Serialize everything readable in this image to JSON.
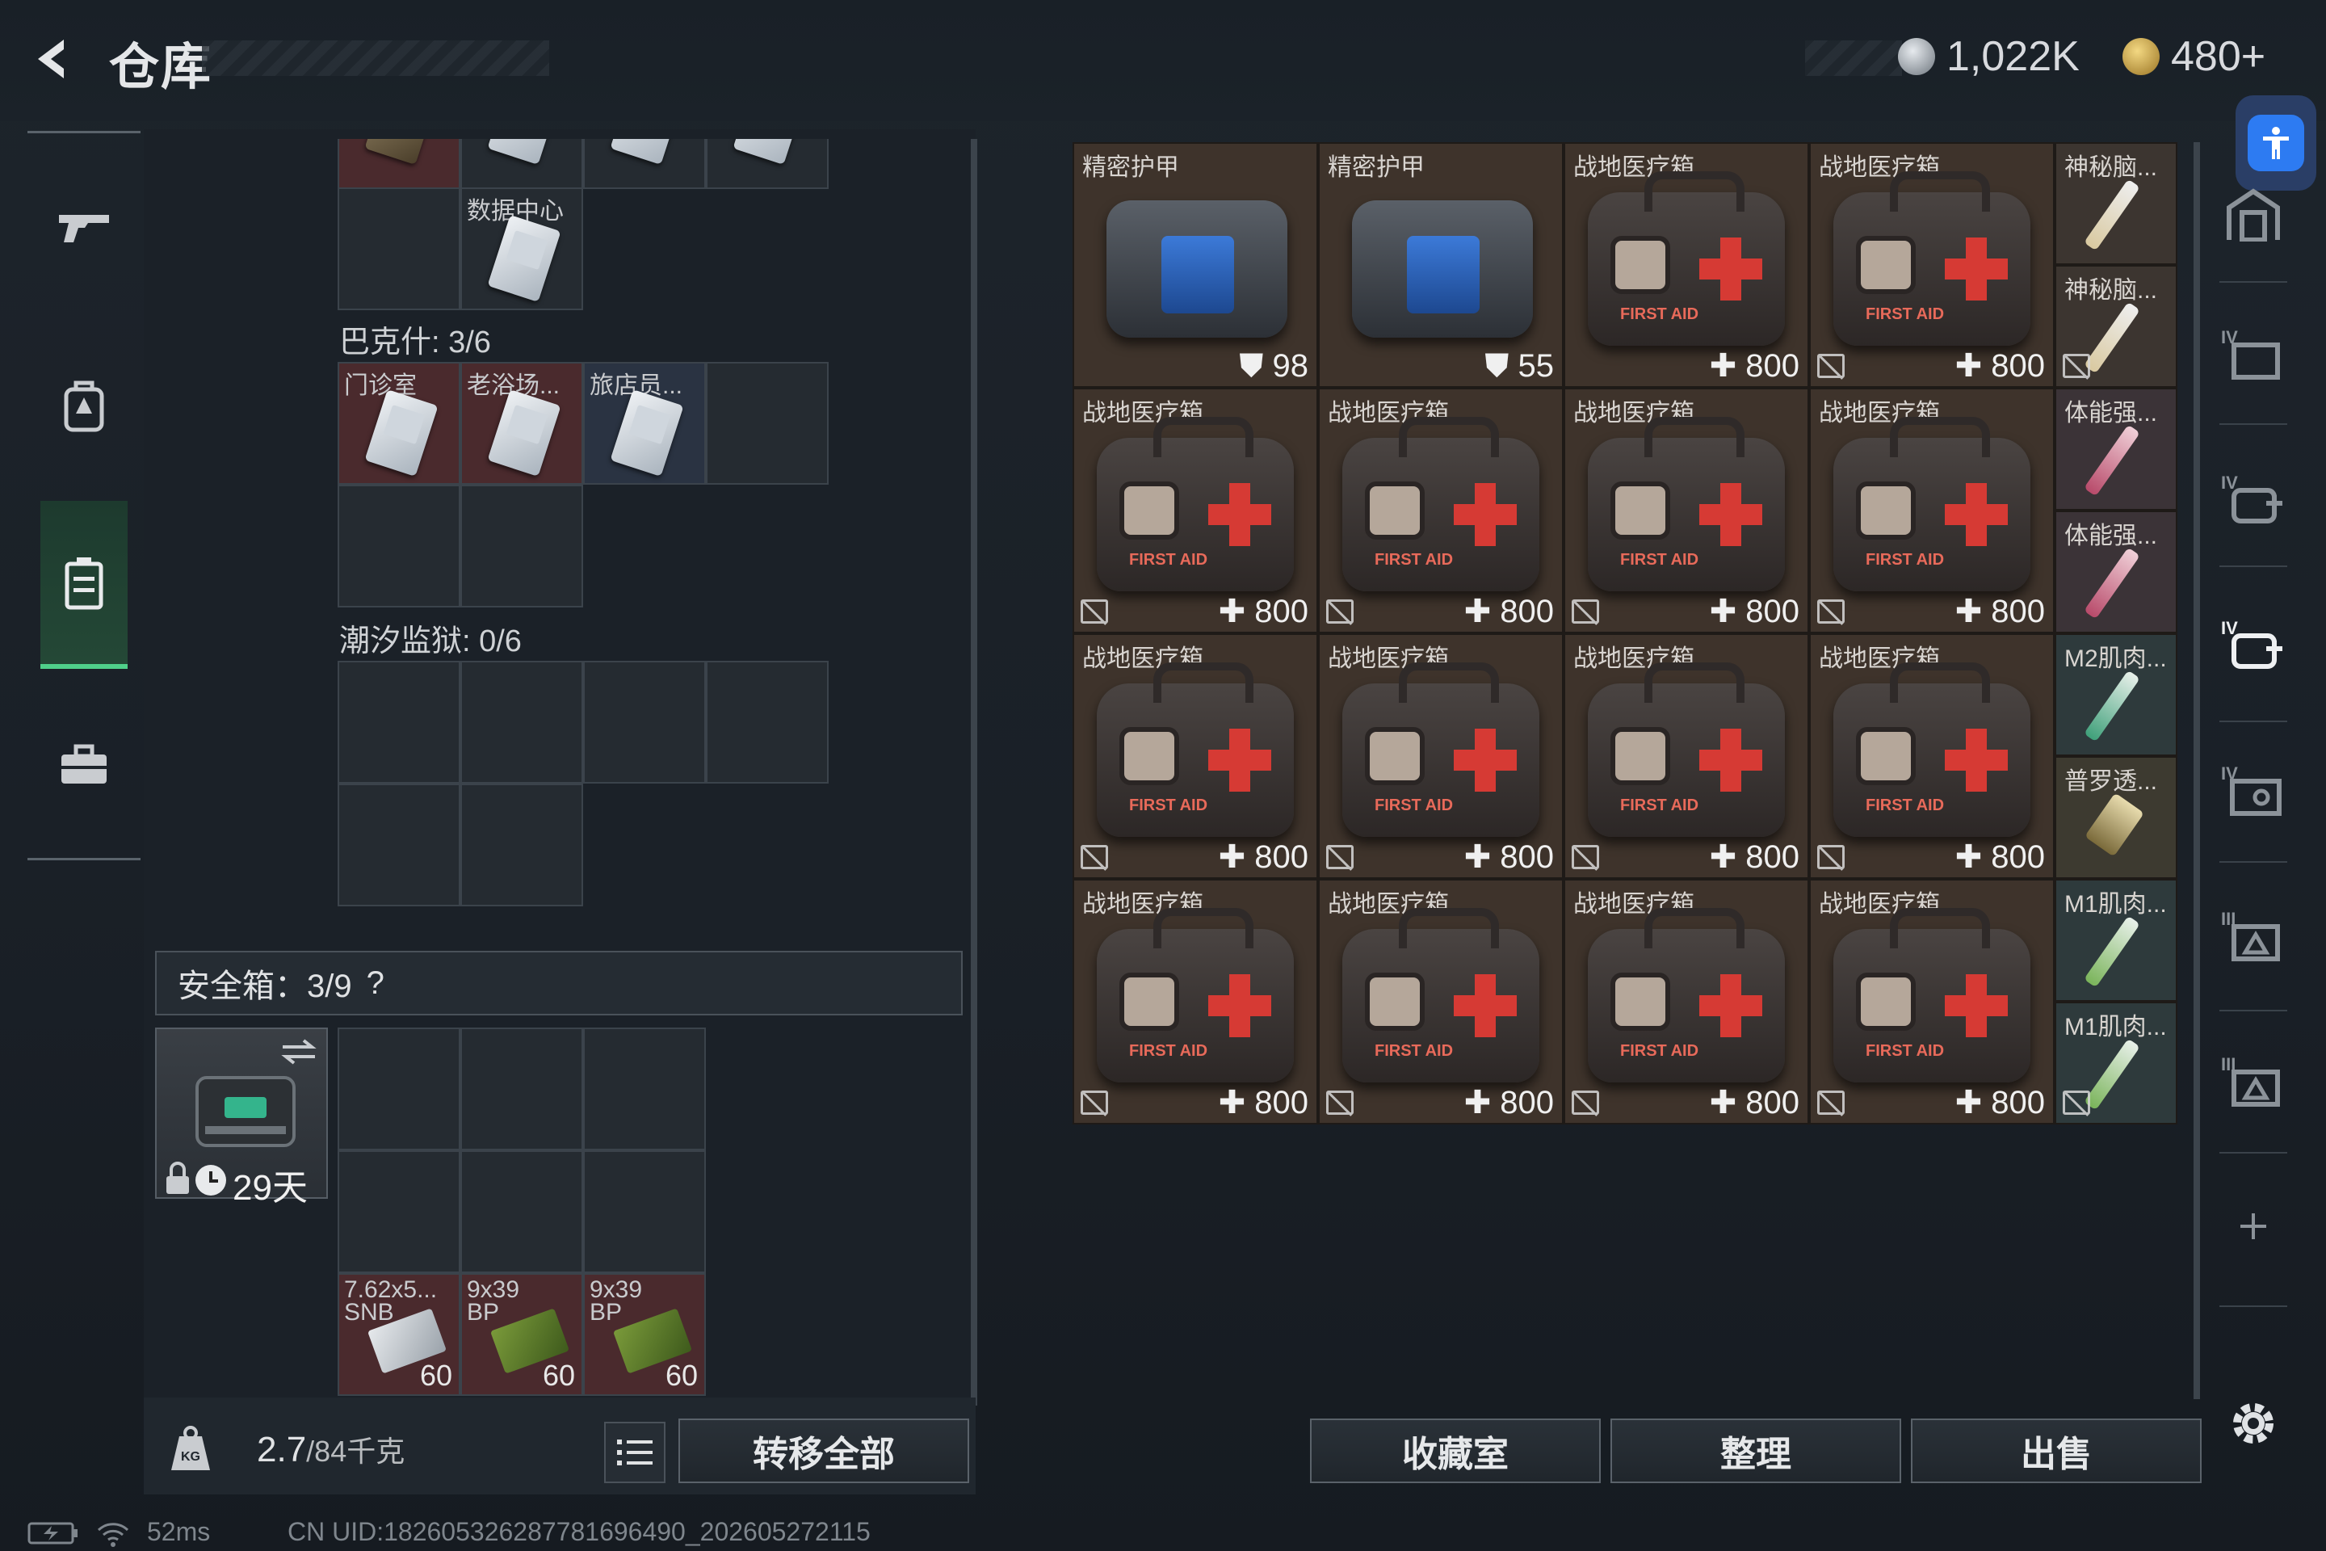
{
  "header": {
    "title": "仓库",
    "currency1": "1,022K",
    "currency2": "480+",
    "currency1_color": "#9aa3ad",
    "currency2_color": "#c8a24a"
  },
  "left_panel": {
    "top_slots": [
      {
        "label": ""
      },
      {
        "label": ""
      },
      {
        "label": ""
      },
      {
        "label": ""
      }
    ],
    "data_center": {
      "label": "数据中心"
    },
    "section1": {
      "title": "巴克什: 3/6",
      "items": [
        {
          "label": "门诊室"
        },
        {
          "label": "老浴场..."
        },
        {
          "label": "旅店员..."
        }
      ]
    },
    "section2": {
      "title": "潮汐监狱: 0/6"
    },
    "safe_box": {
      "title": "安全箱：3/9",
      "help": "?",
      "timer": "29天"
    },
    "ammo": [
      {
        "label": "7.62x5...",
        "sub": "SNB",
        "qty": "60"
      },
      {
        "label": "9x39",
        "sub": "BP",
        "qty": "60"
      },
      {
        "label": "9x39",
        "sub": "BP",
        "qty": "60"
      }
    ],
    "weight": {
      "value": "2.7",
      "max": "/84千克"
    },
    "transfer_all": "转移全部"
  },
  "grid": {
    "row0": [
      {
        "label": "精密护甲",
        "value": "98"
      },
      {
        "label": "精密护甲",
        "value": "55"
      },
      {
        "label": "战地医疗箱",
        "value": "800"
      },
      {
        "label": "战地医疗箱",
        "value": "800"
      }
    ],
    "row1": [
      {
        "label": "战地医疗箱",
        "value": "800"
      },
      {
        "label": "战地医疗箱",
        "value": "800"
      },
      {
        "label": "战地医疗箱",
        "value": "800"
      },
      {
        "label": "战地医疗箱",
        "value": "800"
      }
    ],
    "row2": [
      {
        "label": "战地医疗箱",
        "value": "800"
      },
      {
        "label": "战地医疗箱",
        "value": "800"
      },
      {
        "label": "战地医疗箱",
        "value": "800"
      },
      {
        "label": "战地医疗箱",
        "value": "800"
      }
    ],
    "row3": [
      {
        "label": "战地医疗箱",
        "value": "800"
      },
      {
        "label": "战地医疗箱",
        "value": "800"
      },
      {
        "label": "战地医疗箱",
        "value": "800"
      },
      {
        "label": "战地医疗箱",
        "value": "800"
      }
    ],
    "small": [
      {
        "label": "神秘脑..."
      },
      {
        "label": "神秘脑..."
      },
      {
        "label": "体能强..."
      },
      {
        "label": "体能强..."
      },
      {
        "label": "M2肌肉..."
      },
      {
        "label": "普罗透..."
      },
      {
        "label": "M1肌肉..."
      },
      {
        "label": "M1肌肉..."
      }
    ]
  },
  "bottom_buttons": {
    "collection": "收藏室",
    "organize": "整理",
    "sell": "出售"
  },
  "status": {
    "ping": "52ms",
    "uid": "CN UID:1826053262877816964​90_202605272115"
  }
}
